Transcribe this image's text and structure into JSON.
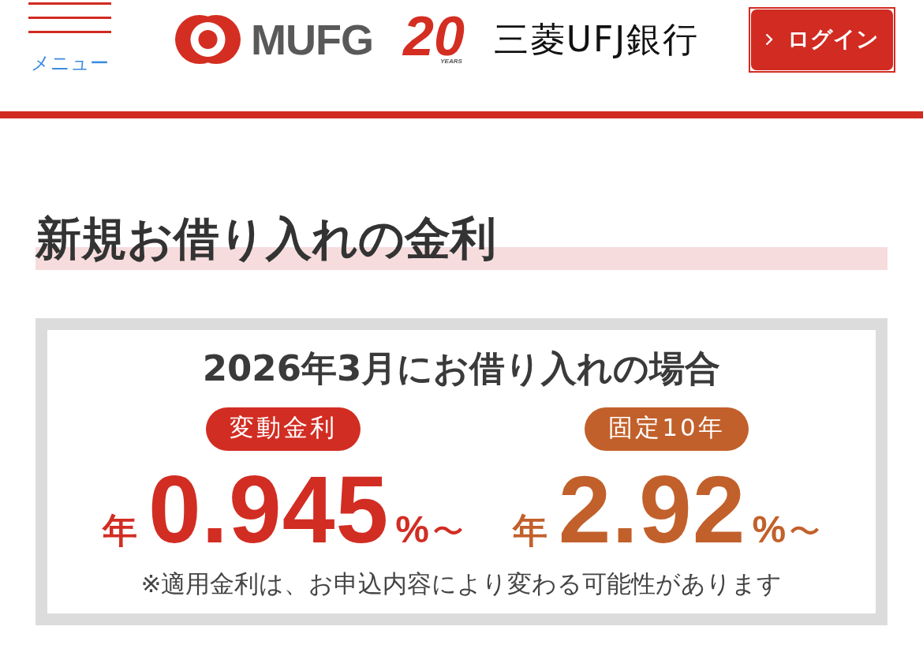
{
  "header": {
    "menu_button": {
      "label": "メニュー"
    },
    "logo": {
      "wordmark": "MUFG"
    },
    "anniversary": {
      "number": "20",
      "caption": "YEARS"
    },
    "bank_name": "三菱UFJ銀行",
    "login_button": {
      "label": "ログイン"
    }
  },
  "section": {
    "heading": "新規お借り入れの金利",
    "rate_card": {
      "title": "2026年3月にお借り入れの場合",
      "rates": [
        {
          "badge": "変動金利",
          "prefix": "年",
          "value": "0.945",
          "unit": "%",
          "range_mark": "〜",
          "color": "#d22d23"
        },
        {
          "badge": "固定10年",
          "prefix": "年",
          "value": "2.92",
          "unit": "%",
          "range_mark": "〜",
          "color": "#c2602b"
        }
      ],
      "note": "※適用金利は、お申込内容により変わる可能性があります"
    }
  }
}
